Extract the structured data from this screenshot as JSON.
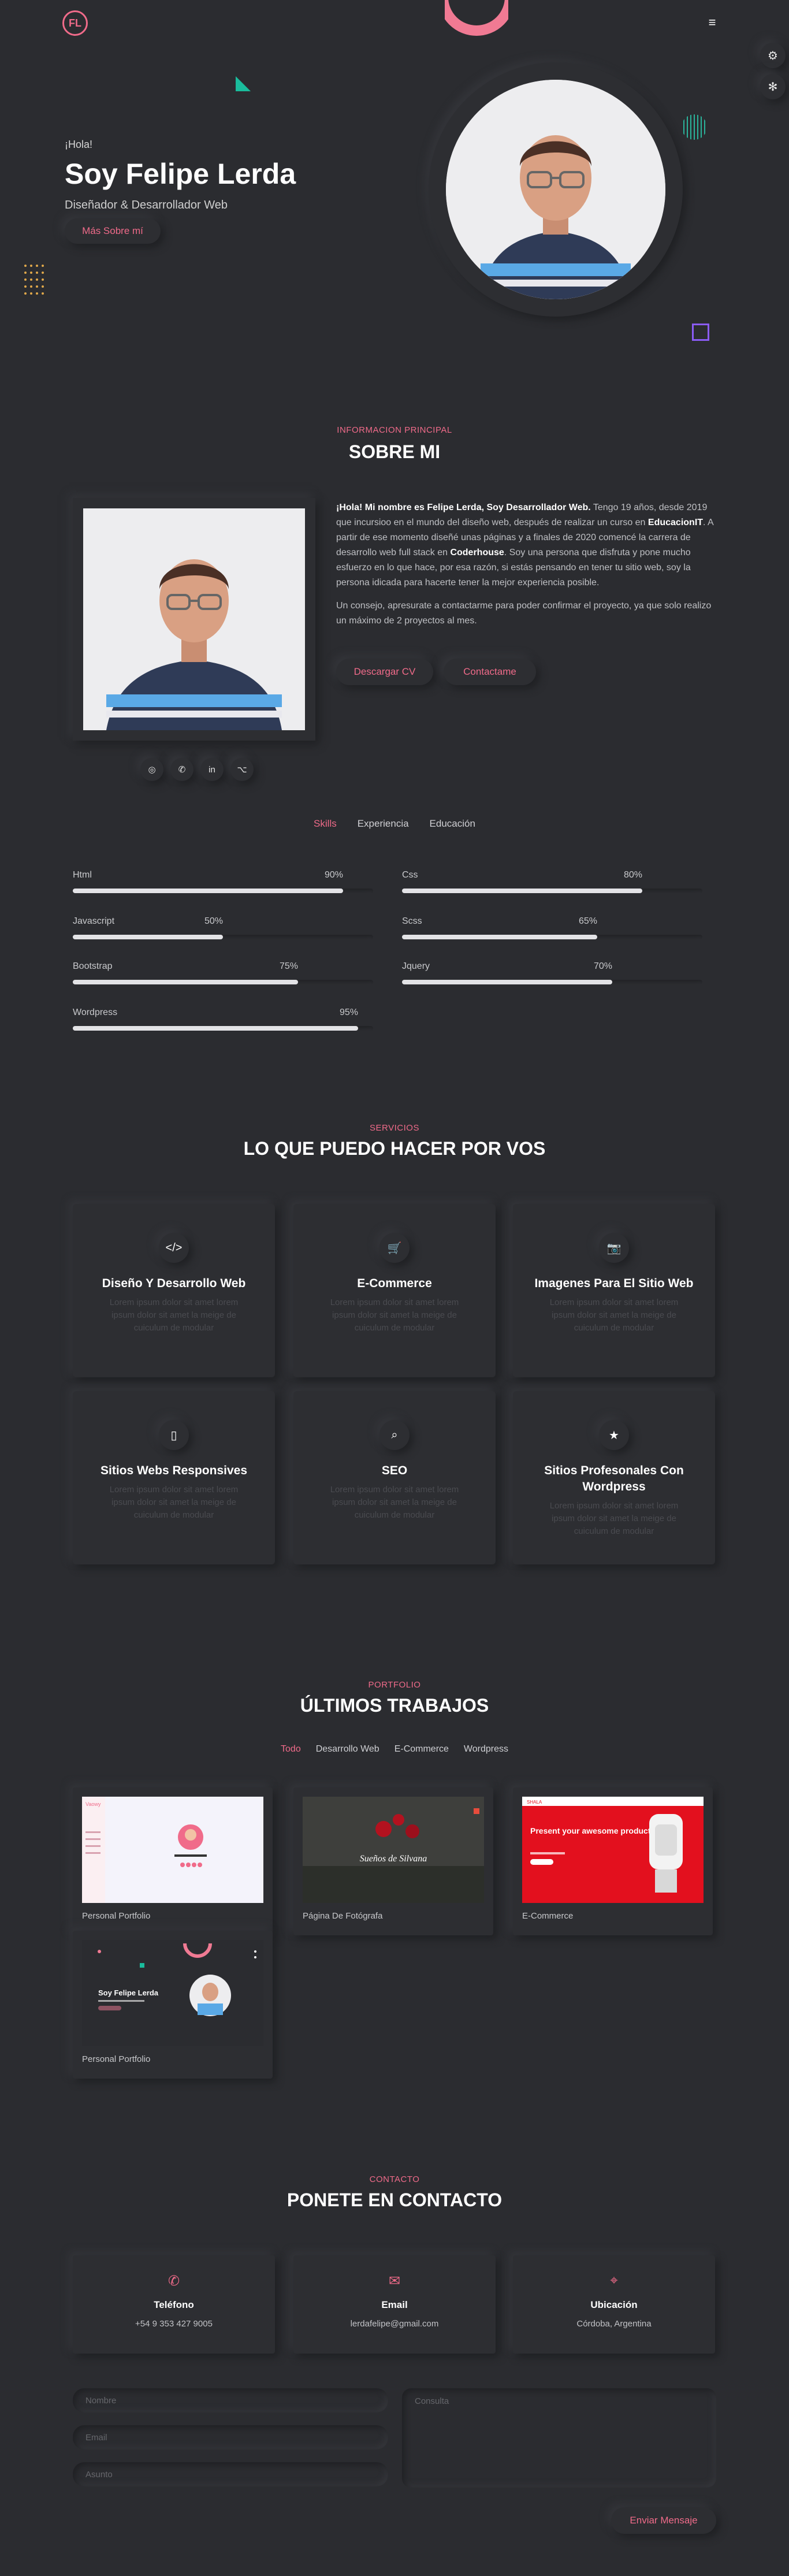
{
  "header": {
    "logo": "FL",
    "menu_icon": "≡",
    "gear1": "⚙",
    "gear2": "✻"
  },
  "hero": {
    "greeting": "¡Hola!",
    "name": "Soy Felipe Lerda",
    "subtitle": "Diseñador & Desarrollador Web",
    "button": "Más Sobre mí"
  },
  "about": {
    "kicker": "INFORMACION PRINCIPAL",
    "title": "SOBRE MI",
    "p1_parts": [
      "¡Hola! Mi nombre es Felipe Lerda, Soy Desarrollador Web.",
      " Tengo 19 años, desde 2019 que incursioo en el mundo del diseño web, después de realizar un curso en ",
      "EducacionIT",
      ". A partir de ese momento diseñé unas páginas y a finales de 2020 comencé la carrera de desarrollo web full stack en ",
      "Coderhouse",
      ". Soy una persona que disfruta y pone mucho esfuerzo en lo que hace, por esa razón, si estás pensando en tener tu sitio web, soy la persona idicada para hacerte tener la mejor experiencia posible."
    ],
    "p2": "Un consejo, apresurate a contactarme para poder confirmar el proyecto, ya que solo realizo un máximo de 2 proyectos al mes.",
    "btn_cv": "Descargar CV",
    "btn_contact": "Contactame",
    "social_icons": [
      "◎",
      "✆",
      "in",
      "⌥"
    ]
  },
  "tabs": [
    "Skills",
    "Experiencia",
    "Educación"
  ],
  "skills": [
    {
      "name": "Html",
      "pct": "90%",
      "value": 90
    },
    {
      "name": "Css",
      "pct": "80%",
      "value": 80
    },
    {
      "name": "Javascript",
      "pct": "50%",
      "value": 50
    },
    {
      "name": "Scss",
      "pct": "65%",
      "value": 65
    },
    {
      "name": "Bootstrap",
      "pct": "75%",
      "value": 75
    },
    {
      "name": "Jquery",
      "pct": "70%",
      "value": 70
    },
    {
      "name": "Wordpress",
      "pct": "95%",
      "value": 95
    }
  ],
  "services": {
    "kicker": "SERVICIOS",
    "title": "LO QUE PUEDO HACER POR VOS",
    "items": [
      {
        "icon": "</>",
        "title": "Diseño Y Desarrollo Web",
        "text": "Lorem ipsum dolor sit amet lorem ipsum dolor sit amet la meige de cuiculum de modular"
      },
      {
        "icon": "🛒",
        "title": "E-Commerce",
        "text": "Lorem ipsum dolor sit amet lorem ipsum dolor sit amet la meige de cuiculum de modular"
      },
      {
        "icon": "📷",
        "title": "Imagenes Para El Sitio Web",
        "text": "Lorem ipsum dolor sit amet lorem ipsum dolor sit amet la meige de cuiculum de modular"
      },
      {
        "icon": "▯",
        "title": "Sitios Webs Responsives",
        "text": "Lorem ipsum dolor sit amet lorem ipsum dolor sit amet la meige de cuiculum de modular"
      },
      {
        "icon": "⌕",
        "title": "SEO",
        "text": "Lorem ipsum dolor sit amet lorem ipsum dolor sit amet la meige de cuiculum de modular"
      },
      {
        "icon": "★",
        "title": "Sitios Profesonales Con Wordpress",
        "text": "Lorem ipsum dolor sit amet lorem ipsum dolor sit amet la meige de cuiculum de modular"
      }
    ]
  },
  "portfolio": {
    "kicker": "PORTFOLIO",
    "title": "ÚLTIMOS TRABAJOS",
    "filters": [
      "Todo",
      "Desarrollo Web",
      "E-Commerce",
      "Wordpress"
    ],
    "items": [
      {
        "label": "Personal Portfolio"
      },
      {
        "label": "Página De Fotógrafa",
        "thumb_text": "Sueños de Silvana"
      },
      {
        "label": "E-Commerce",
        "thumb_text": "Present your awesome product"
      },
      {
        "label": "Personal Portfolio",
        "thumb_text": "Soy Felipe Lerda"
      }
    ]
  },
  "contact": {
    "kicker": "CONTACTO",
    "title": "PONETE EN CONTACTO",
    "boxes": [
      {
        "icon": "✆",
        "title": "Teléfono",
        "value": "+54 9 353 427 9005"
      },
      {
        "icon": "✉",
        "title": "Email",
        "value": "lerdafelipe@gmail.com"
      },
      {
        "icon": "⌖",
        "title": "Ubicación",
        "value": "Córdoba, Argentina"
      }
    ],
    "form": {
      "name_ph": "Nombre",
      "email_ph": "Email",
      "subject_ph": "Asunto",
      "message_ph": "Consulta",
      "send": "Enviar Mensaje"
    }
  },
  "colors": {
    "accent": "#f06b8a",
    "bg": "#2b2c30"
  }
}
